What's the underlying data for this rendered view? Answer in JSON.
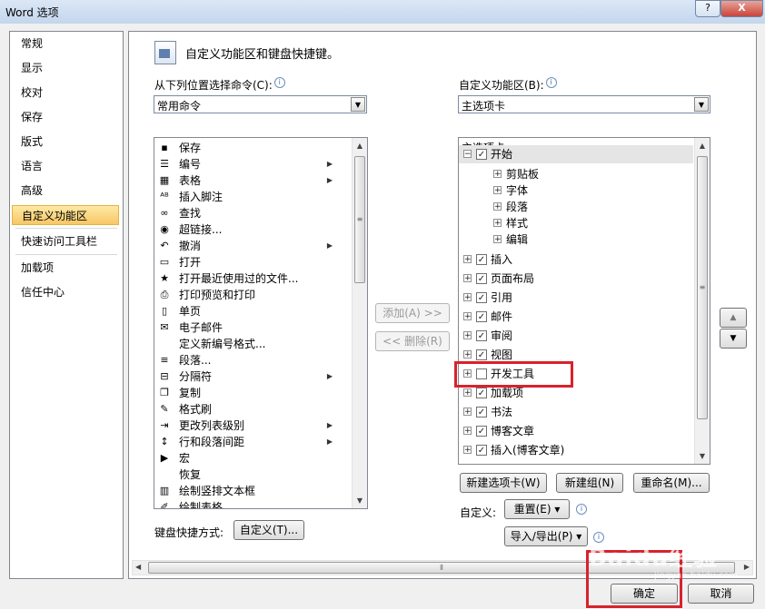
{
  "window": {
    "title": "Word 选项",
    "help": "?",
    "close": "X"
  },
  "nav": {
    "items": [
      {
        "label": "常规"
      },
      {
        "label": "显示"
      },
      {
        "label": "校对"
      },
      {
        "label": "保存"
      },
      {
        "label": "版式"
      },
      {
        "label": "语言"
      },
      {
        "label": "高级"
      },
      {
        "label": "自定义功能区"
      },
      {
        "label": "快速访问工具栏"
      },
      {
        "label": "加载项"
      },
      {
        "label": "信任中心"
      }
    ],
    "selected": "自定义功能区"
  },
  "header": {
    "text": "自定义功能区和键盘快捷键。"
  },
  "left": {
    "label": "从下列位置选择命令(C):",
    "combo_value": "常用命令",
    "commands": [
      {
        "label": "保存",
        "icon": "save-icon",
        "glyph": "▪",
        "sub": false
      },
      {
        "label": "编号",
        "icon": "numbering-icon",
        "glyph": "☰",
        "sub": true
      },
      {
        "label": "表格",
        "icon": "table-icon",
        "glyph": "▦",
        "sub": true
      },
      {
        "label": "插入脚注",
        "icon": "footnote-icon",
        "glyph": "ᴬᴮ",
        "sub": false
      },
      {
        "label": "查找",
        "icon": "binoculars-icon",
        "glyph": "∞",
        "sub": false
      },
      {
        "label": "超链接...",
        "icon": "hyperlink-icon",
        "glyph": "◉",
        "sub": false
      },
      {
        "label": "撤消",
        "icon": "undo-icon",
        "glyph": "↶",
        "sub": true
      },
      {
        "label": "打开",
        "icon": "open-folder-icon",
        "glyph": "▭",
        "sub": false
      },
      {
        "label": "打开最近使用过的文件...",
        "icon": "recent-files-icon",
        "glyph": "★",
        "sub": false
      },
      {
        "label": "打印预览和打印",
        "icon": "print-preview-icon",
        "glyph": "⎙",
        "sub": false
      },
      {
        "label": "单页",
        "icon": "one-page-icon",
        "glyph": "▯",
        "sub": false
      },
      {
        "label": "电子邮件",
        "icon": "email-icon",
        "glyph": "✉",
        "sub": false
      },
      {
        "label": "定义新编号格式...",
        "icon": "none",
        "glyph": "",
        "sub": false
      },
      {
        "label": "段落...",
        "icon": "paragraph-icon",
        "glyph": "≡",
        "sub": false
      },
      {
        "label": "分隔符",
        "icon": "breaks-icon",
        "glyph": "⊟",
        "sub": true
      },
      {
        "label": "复制",
        "icon": "copy-icon",
        "glyph": "❐",
        "sub": false
      },
      {
        "label": "格式刷",
        "icon": "format-painter-icon",
        "glyph": "✎",
        "sub": false
      },
      {
        "label": "更改列表级别",
        "icon": "list-level-icon",
        "glyph": "⇥",
        "sub": true
      },
      {
        "label": "行和段落间距",
        "icon": "line-spacing-icon",
        "glyph": "↕",
        "sub": true
      },
      {
        "label": "宏",
        "icon": "macro-icon",
        "glyph": "▶",
        "sub": false
      },
      {
        "label": "恢复",
        "icon": "none",
        "glyph": "",
        "sub": false
      },
      {
        "label": "绘制竖排文本框",
        "icon": "vertical-textbox-icon",
        "glyph": "▥",
        "sub": false
      },
      {
        "label": "绘制表格",
        "icon": "draw-table-icon",
        "glyph": "✐",
        "sub": false
      }
    ]
  },
  "middle": {
    "add": "添加(A) >>",
    "remove": "<< 删除(R)"
  },
  "right": {
    "label": "自定义功能区(B):",
    "combo_value": "主选项卡",
    "tree_header": "主选项卡",
    "tree": [
      {
        "label": "开始",
        "level": 0,
        "exp": "−",
        "checked": true
      },
      {
        "label": "剪贴板",
        "level": 1,
        "exp": "+",
        "checked": null
      },
      {
        "label": "字体",
        "level": 1,
        "exp": "+",
        "checked": null
      },
      {
        "label": "段落",
        "level": 1,
        "exp": "+",
        "checked": null
      },
      {
        "label": "样式",
        "level": 1,
        "exp": "+",
        "checked": null
      },
      {
        "label": "编辑",
        "level": 1,
        "exp": "+",
        "checked": null
      },
      {
        "label": "插入",
        "level": 0,
        "exp": "+",
        "checked": true
      },
      {
        "label": "页面布局",
        "level": 0,
        "exp": "+",
        "checked": true
      },
      {
        "label": "引用",
        "level": 0,
        "exp": "+",
        "checked": true
      },
      {
        "label": "邮件",
        "level": 0,
        "exp": "+",
        "checked": true
      },
      {
        "label": "审阅",
        "level": 0,
        "exp": "+",
        "checked": true
      },
      {
        "label": "视图",
        "level": 0,
        "exp": "+",
        "checked": true
      },
      {
        "label": "开发工具",
        "level": 0,
        "exp": "+",
        "checked": false
      },
      {
        "label": "加载项",
        "level": 0,
        "exp": "+",
        "checked": true
      },
      {
        "label": "书法",
        "level": 0,
        "exp": "+",
        "checked": true
      },
      {
        "label": "博客文章",
        "level": 0,
        "exp": "+",
        "checked": true
      },
      {
        "label": "插入(博客文章)",
        "level": 0,
        "exp": "+",
        "checked": true
      }
    ],
    "buttons": {
      "new_tab": "新建选项卡(W)",
      "new_group": "新建组(N)",
      "rename": "重命名(M)..."
    },
    "customize_label": "自定义:",
    "reset": "重置(E) ▾",
    "import_export": "导入/导出(P) ▾"
  },
  "keyboard": {
    "label": "键盘快捷方式:",
    "button": "自定义(T)..."
  },
  "footer": {
    "ok": "确定",
    "cancel": "取消"
  },
  "watermark": {
    "logo": "Baidu经验",
    "sub": "jingyan.baidu.com"
  },
  "glyphs": {
    "info": "i",
    "check": "✓",
    "up": "▲",
    "down": "▼",
    "dropdown": "▼",
    "submenu": "▶",
    "grip": "≡",
    "hgrip": "⦀",
    "left": "◀",
    "right": "▶"
  },
  "colors": {
    "highlight": "#d8222d",
    "nav_selected": "#f7c766"
  }
}
